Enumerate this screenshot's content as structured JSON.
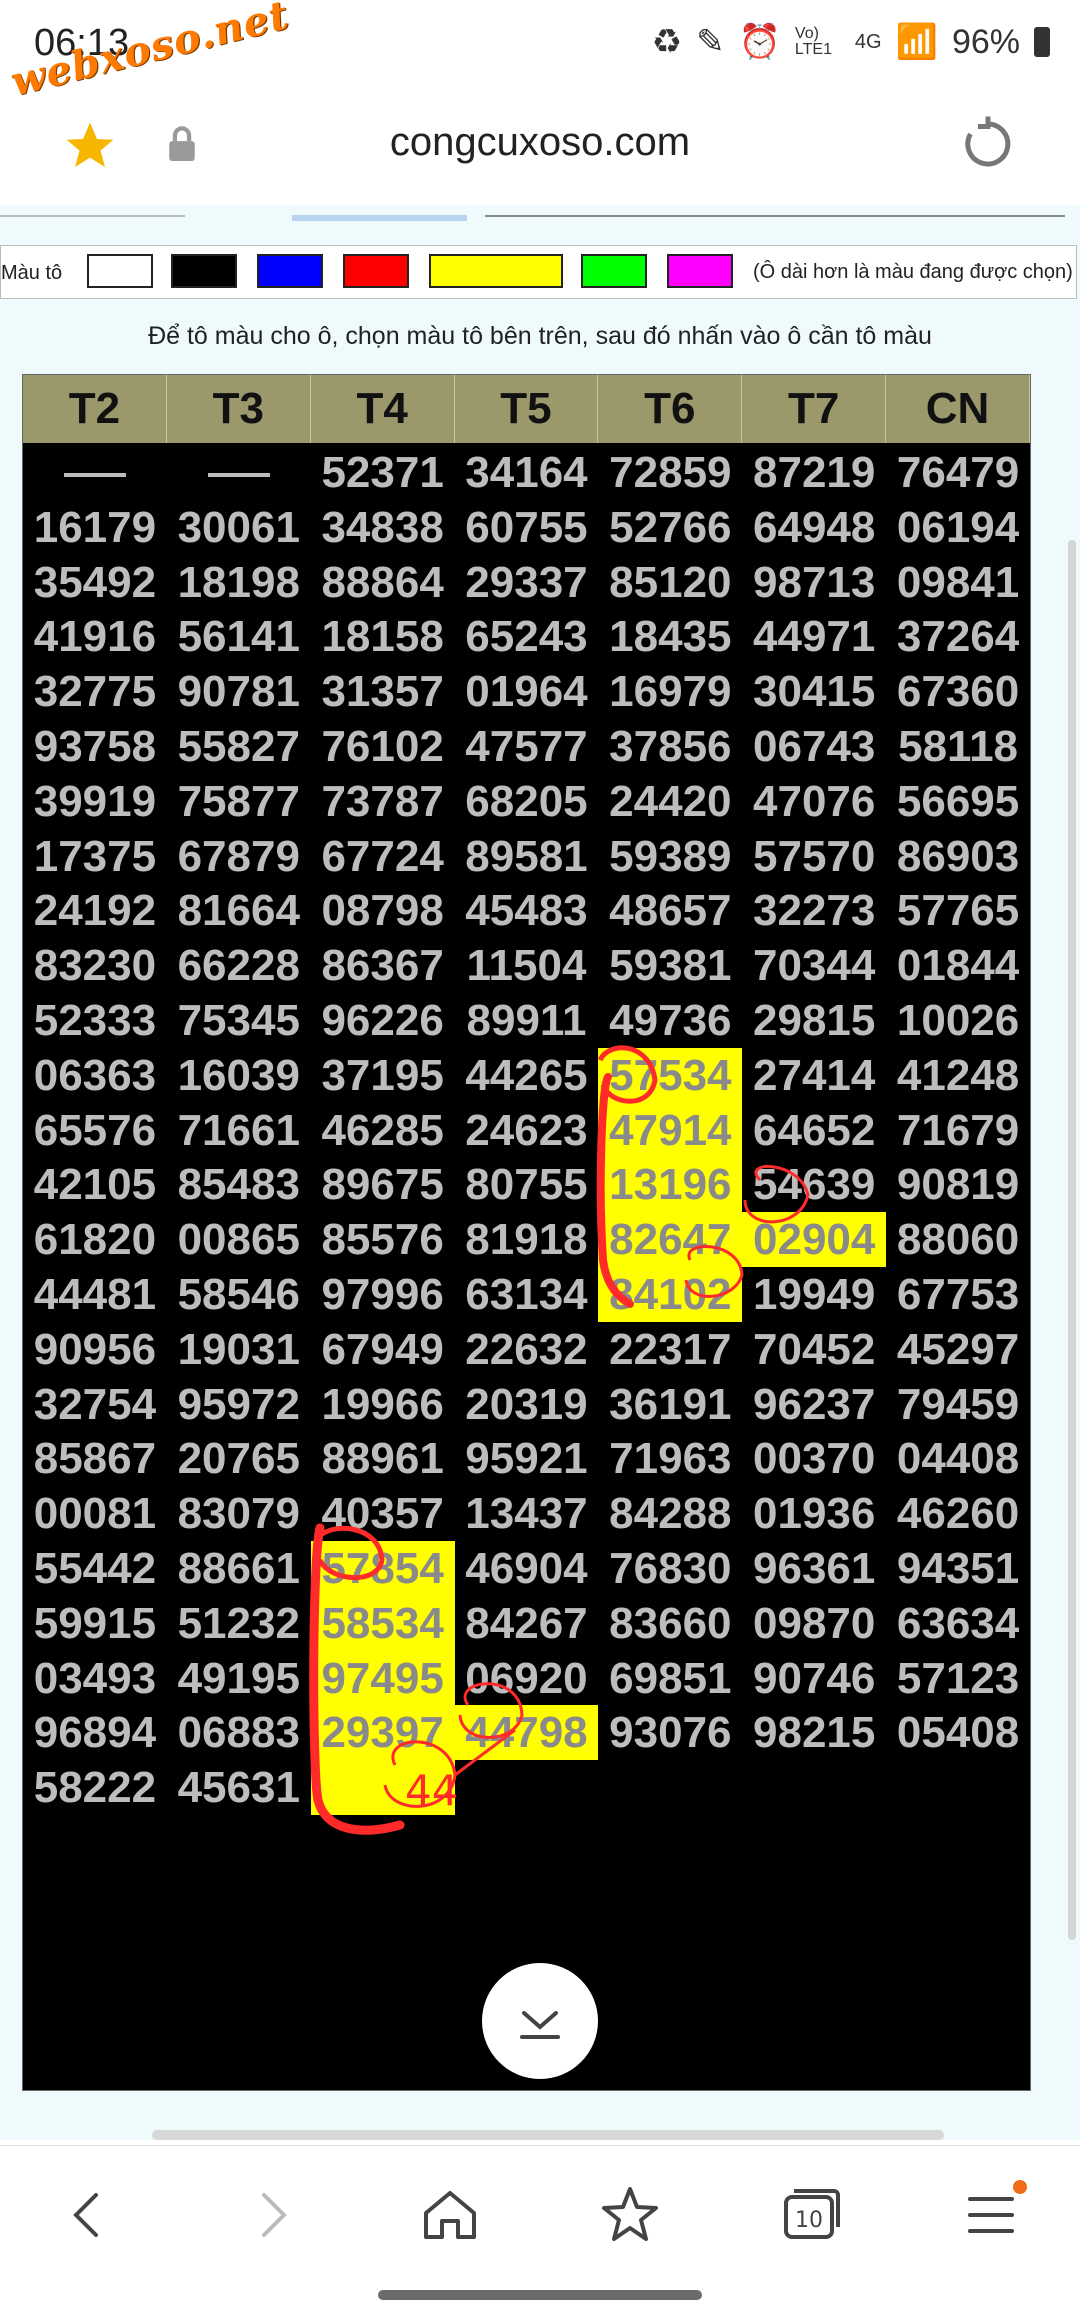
{
  "status_bar": {
    "time": "06:13",
    "network_label": "Vo) LTE1",
    "network_type": "4G",
    "battery": "96%"
  },
  "watermark": "webxoso.net",
  "browser": {
    "url": "congcuxoso.com"
  },
  "palette": {
    "label": "Màu tô",
    "swatches": [
      "#ffffff",
      "#000000",
      "#0000ff",
      "#ff0000",
      "#ffff00",
      "#00ff00",
      "#ff00ff"
    ],
    "note": "(Ô dài hơn là màu đang được chọn)"
  },
  "instruction": "Để tô màu cho ô, chọn màu tô bên trên, sau đó nhấn vào ô cần tô màu",
  "table": {
    "headers": [
      "T2",
      "T3",
      "T4",
      "T5",
      "T6",
      "T7",
      "CN"
    ],
    "rows": [
      [
        "—",
        "—",
        "52371",
        "34164",
        "72859",
        "87219",
        "76479"
      ],
      [
        "16179",
        "30061",
        "34838",
        "60755",
        "52766",
        "64948",
        "06194"
      ],
      [
        "35492",
        "18198",
        "88864",
        "29337",
        "85120",
        "98713",
        "09841"
      ],
      [
        "41916",
        "56141",
        "18158",
        "65243",
        "18435",
        "44971",
        "37264"
      ],
      [
        "32775",
        "90781",
        "31357",
        "01964",
        "16979",
        "30415",
        "67360"
      ],
      [
        "93758",
        "55827",
        "76102",
        "47577",
        "37856",
        "06743",
        "58118"
      ],
      [
        "39919",
        "75877",
        "73787",
        "68205",
        "24420",
        "47076",
        "56695"
      ],
      [
        "17375",
        "67879",
        "67724",
        "89581",
        "59389",
        "57570",
        "86903"
      ],
      [
        "24192",
        "81664",
        "08798",
        "45483",
        "48657",
        "32273",
        "57765"
      ],
      [
        "83230",
        "66228",
        "86367",
        "11504",
        "59381",
        "70344",
        "01844"
      ],
      [
        "52333",
        "75345",
        "96226",
        "89911",
        "49736",
        "29815",
        "10026"
      ],
      [
        "06363",
        "16039",
        "37195",
        "44265",
        "57534",
        "27414",
        "41248"
      ],
      [
        "65576",
        "71661",
        "46285",
        "24623",
        "47914",
        "64652",
        "71679"
      ],
      [
        "42105",
        "85483",
        "89675",
        "80755",
        "13196",
        "54639",
        "90819"
      ],
      [
        "61820",
        "00865",
        "85576",
        "81918",
        "82647",
        "02904",
        "88060"
      ],
      [
        "44481",
        "58546",
        "97996",
        "63134",
        "84102",
        "19949",
        "67753"
      ],
      [
        "90956",
        "19031",
        "67949",
        "22632",
        "22317",
        "70452",
        "45297"
      ],
      [
        "32754",
        "95972",
        "19966",
        "20319",
        "36191",
        "96237",
        "79459"
      ],
      [
        "85867",
        "20765",
        "88961",
        "95921",
        "71963",
        "00370",
        "04408"
      ],
      [
        "00081",
        "83079",
        "40357",
        "13437",
        "84288",
        "01936",
        "46260"
      ],
      [
        "55442",
        "88661",
        "57854",
        "46904",
        "76830",
        "96361",
        "94351"
      ],
      [
        "59915",
        "51232",
        "58534",
        "84267",
        "83660",
        "09870",
        "63634"
      ],
      [
        "03493",
        "49195",
        "97495",
        "06920",
        "69851",
        "90746",
        "57123"
      ],
      [
        "96894",
        "06883",
        "29397",
        "44798",
        "93076",
        "98215",
        "05408"
      ],
      [
        "58222",
        "45631",
        "",
        "",
        "",
        "",
        ""
      ]
    ],
    "highlighted": [
      [
        11,
        4
      ],
      [
        12,
        4
      ],
      [
        13,
        4
      ],
      [
        14,
        4
      ],
      [
        14,
        5
      ],
      [
        15,
        4
      ],
      [
        20,
        2
      ],
      [
        21,
        2
      ],
      [
        22,
        2
      ],
      [
        23,
        2
      ],
      [
        23,
        3
      ],
      [
        24,
        2
      ]
    ],
    "highlight_color": "#ffff00"
  },
  "annotation": {
    "handwritten_text": "44",
    "stroke_color": "#ff1a1a"
  }
}
